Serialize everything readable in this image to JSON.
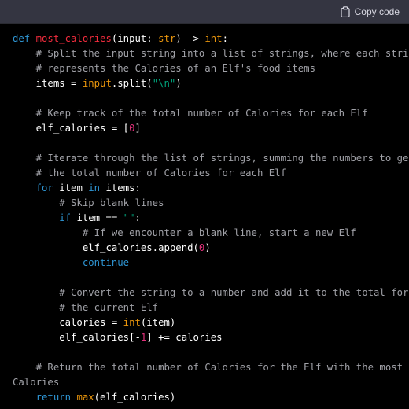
{
  "toolbar": {
    "copy_label": "Copy code",
    "copy_icon": "clipboard-icon"
  },
  "theme": {
    "background": "#000000",
    "toolbar_bg": "#343541",
    "keyword": "#2e95d3",
    "function": "#f22c3d",
    "comment": "#a0a1a7",
    "builtin": "#e9950c",
    "number": "#df3079",
    "string": "#00a67d"
  },
  "code": {
    "lines": [
      [
        {
          "t": "kw",
          "v": "def "
        },
        {
          "t": "fn",
          "v": "most_calories"
        },
        {
          "t": "",
          "v": "(input: "
        },
        {
          "t": "bi",
          "v": "str"
        },
        {
          "t": "",
          "v": ") -> "
        },
        {
          "t": "bi",
          "v": "int"
        },
        {
          "t": "",
          "v": ":"
        }
      ],
      [
        {
          "t": "cm",
          "v": "    # Split the input string into a list of strings, where each string"
        }
      ],
      [
        {
          "t": "cm",
          "v": "    # represents the Calories of an Elf's food items"
        }
      ],
      [
        {
          "t": "",
          "v": "    items = "
        },
        {
          "t": "bi",
          "v": "input"
        },
        {
          "t": "",
          "v": ".split("
        },
        {
          "t": "str",
          "v": "\"\\n\""
        },
        {
          "t": "",
          "v": ")"
        }
      ],
      [],
      [
        {
          "t": "cm",
          "v": "    # Keep track of the total number of Calories for each Elf"
        }
      ],
      [
        {
          "t": "",
          "v": "    elf_calories = ["
        },
        {
          "t": "num",
          "v": "0"
        },
        {
          "t": "",
          "v": "]"
        }
      ],
      [],
      [
        {
          "t": "cm",
          "v": "    # Iterate through the list of strings, summing the numbers to get"
        }
      ],
      [
        {
          "t": "cm",
          "v": "    # the total number of Calories for each Elf"
        }
      ],
      [
        {
          "t": "kw",
          "v": "    for "
        },
        {
          "t": "",
          "v": "item "
        },
        {
          "t": "kw",
          "v": "in "
        },
        {
          "t": "",
          "v": "items:"
        }
      ],
      [
        {
          "t": "cm",
          "v": "        # Skip blank lines"
        }
      ],
      [
        {
          "t": "kw",
          "v": "        if "
        },
        {
          "t": "",
          "v": "item == "
        },
        {
          "t": "str",
          "v": "\"\""
        },
        {
          "t": "",
          "v": ":"
        }
      ],
      [
        {
          "t": "cm",
          "v": "            # If we encounter a blank line, start a new Elf"
        }
      ],
      [
        {
          "t": "",
          "v": "            elf_calories.append("
        },
        {
          "t": "num",
          "v": "0"
        },
        {
          "t": "",
          "v": ")"
        }
      ],
      [
        {
          "t": "kw",
          "v": "            continue"
        }
      ],
      [],
      [
        {
          "t": "cm",
          "v": "        # Convert the string to a number and add it to the total for"
        }
      ],
      [
        {
          "t": "cm",
          "v": "        # the current Elf"
        }
      ],
      [
        {
          "t": "",
          "v": "        calories = "
        },
        {
          "t": "bi",
          "v": "int"
        },
        {
          "t": "",
          "v": "(item)"
        }
      ],
      [
        {
          "t": "",
          "v": "        elf_calories[-"
        },
        {
          "t": "num",
          "v": "1"
        },
        {
          "t": "",
          "v": "] += calories"
        }
      ],
      [],
      [
        {
          "t": "cm",
          "v": "    # Return the total number of Calories for the Elf with the most"
        }
      ],
      [
        {
          "t": "cm",
          "v": "Calories"
        }
      ],
      [
        {
          "t": "kw",
          "v": "    return "
        },
        {
          "t": "bi",
          "v": "max"
        },
        {
          "t": "",
          "v": "(elf_calories)"
        }
      ]
    ]
  }
}
